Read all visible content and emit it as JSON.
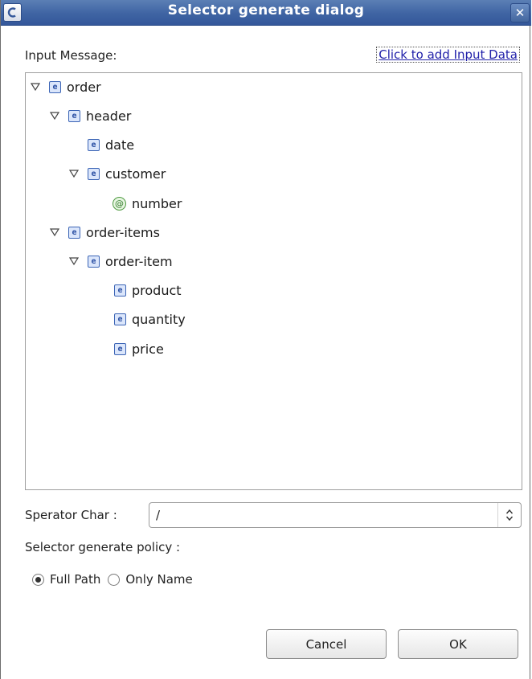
{
  "dialog": {
    "title": "Selector generate dialog",
    "close_glyph": "✕"
  },
  "input": {
    "label": "Input Message:",
    "add_link": "Click to add Input Data"
  },
  "tree": [
    {
      "label": "order",
      "kind": "element",
      "expanded": true
    },
    {
      "label": "header",
      "kind": "element",
      "expanded": true
    },
    {
      "label": "date",
      "kind": "element",
      "expanded": null
    },
    {
      "label": "customer",
      "kind": "element",
      "expanded": true
    },
    {
      "label": "number",
      "kind": "attribute",
      "expanded": null
    },
    {
      "label": "order-items",
      "kind": "element",
      "expanded": true
    },
    {
      "label": "order-item",
      "kind": "element",
      "expanded": true
    },
    {
      "label": "product",
      "kind": "element",
      "expanded": null
    },
    {
      "label": "quantity",
      "kind": "element",
      "expanded": null
    },
    {
      "label": "price",
      "kind": "element",
      "expanded": null
    }
  ],
  "icons": {
    "element": "e",
    "attribute": "@"
  },
  "separator": {
    "label": "Sperator Char :",
    "value": "/"
  },
  "policy": {
    "label": "Selector generate policy :",
    "options": [
      {
        "label": "Full Path",
        "selected": true
      },
      {
        "label": "Only Name",
        "selected": false
      }
    ]
  },
  "buttons": {
    "cancel": "Cancel",
    "ok": "OK"
  },
  "colors": {
    "titlebar": "#3f64a3",
    "link": "#2222aa",
    "element_icon": "#3b64b5",
    "attribute_icon": "#4f9a42"
  }
}
